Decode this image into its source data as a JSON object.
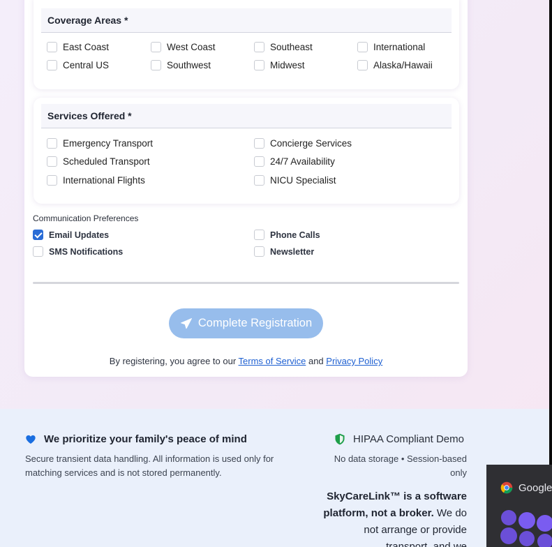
{
  "coverage": {
    "title": "Coverage Areas *",
    "options": [
      {
        "label": "East Coast",
        "checked": false
      },
      {
        "label": "West Coast",
        "checked": false
      },
      {
        "label": "Southeast",
        "checked": false
      },
      {
        "label": "International",
        "checked": false
      },
      {
        "label": "Central US",
        "checked": false
      },
      {
        "label": "Southwest",
        "checked": false
      },
      {
        "label": "Midwest",
        "checked": false
      },
      {
        "label": "Alaska/Hawaii",
        "checked": false
      }
    ]
  },
  "services": {
    "title": "Services Offered *",
    "options": [
      {
        "label": "Emergency Transport",
        "checked": false
      },
      {
        "label": "Concierge Services",
        "checked": false
      },
      {
        "label": "Scheduled Transport",
        "checked": false
      },
      {
        "label": "24/7 Availability",
        "checked": false
      },
      {
        "label": "International Flights",
        "checked": false
      },
      {
        "label": "NICU Specialist",
        "checked": false
      }
    ]
  },
  "communication": {
    "title": "Communication Preferences",
    "options": [
      {
        "label": "Email Updates",
        "checked": true
      },
      {
        "label": "Phone Calls",
        "checked": false
      },
      {
        "label": "SMS Notifications",
        "checked": false
      },
      {
        "label": "Newsletter",
        "checked": false
      }
    ]
  },
  "submit": {
    "label": "Complete Registration",
    "icon": "paper-plane-icon"
  },
  "agreement": {
    "prefix": "By registering, you agree to our ",
    "terms": "Terms of Service",
    "middle": " and ",
    "privacy": "Privacy Policy"
  },
  "footer": {
    "title": "We prioritize your family's peace of mind",
    "description": "Secure transient data handling. All information is used only for matching services and is not stored permanently.",
    "hipaa": "HIPAA Compliant Demo",
    "storage_note": "No data storage • Session-based only",
    "brand": "SkyCareLink™ is a software platform, not a broker.",
    "disclaimer": " We do not arrange or provide transport, and we"
  },
  "notification": {
    "app": "Google"
  },
  "colors": {
    "accent": "#2a6cd6",
    "button": "#97bdec",
    "heart": "#1a6ee0",
    "shield": "#1e9e4a",
    "footer_bg": "#eaf0fb"
  }
}
